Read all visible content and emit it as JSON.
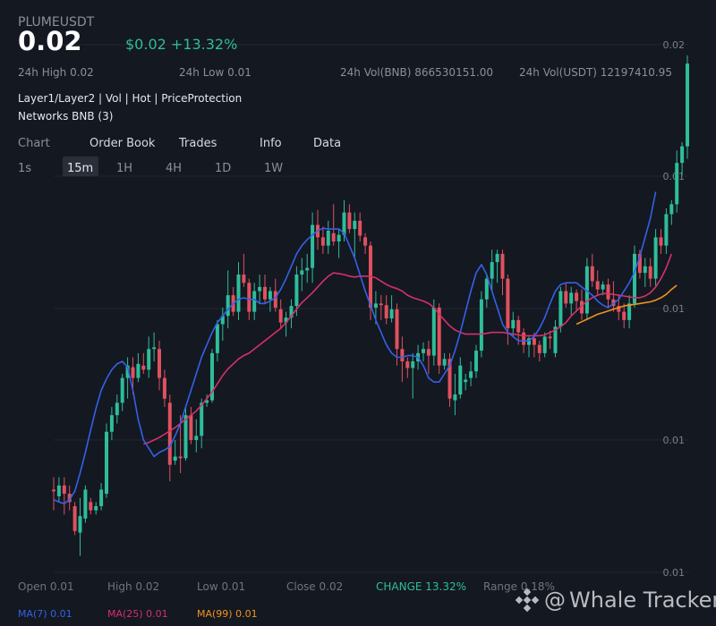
{
  "header": {
    "symbol": "PLUMEUSDT",
    "price": "0.02",
    "change": "$0.02 +13.32%"
  },
  "stats": {
    "high": "24h High 0.02",
    "low": "24h Low 0.01",
    "vol_bnb": "24h Vol(BNB) 866530151.00",
    "vol_usdt": "24h Vol(USDT) 12197410.95"
  },
  "tags": "Layer1/Layer2 | Vol | Hot | PriceProtection",
  "networks": "Networks BNB (3)",
  "tabs": [
    "Chart",
    "Order Book",
    "Trades",
    "Info",
    "Data"
  ],
  "intervals": [
    "1s",
    "15m",
    "1H",
    "4H",
    "1D",
    "1W"
  ],
  "active_interval": "15m",
  "footer": {
    "open": "Open 0.01",
    "high": "High 0.02",
    "low": "Low 0.01",
    "close": "Close 0.02",
    "change": "CHANGE 13.32%",
    "range": "Range 0.18%"
  },
  "ma": {
    "ma7": "MA(7) 0.01",
    "ma25": "MA(25) 0.01",
    "ma99": "MA(99) 0.01"
  },
  "watermark": "Whale Tracker",
  "colors": {
    "up": "#2ebd9a",
    "down": "#e0515f",
    "ma7": "#3461e8",
    "ma25": "#d6306b",
    "ma99": "#f0931e",
    "background": "#141821"
  },
  "chart_data": {
    "type": "candlestick",
    "y_tick_labels": [
      "0.02",
      "0.01",
      "0.01",
      "0.01",
      "0.01"
    ],
    "candles": [
      {
        "o": 0.0106,
        "h": 0.01075,
        "l": 0.01035,
        "c": 0.01058
      },
      {
        "o": 0.01052,
        "h": 0.01075,
        "l": 0.01045,
        "c": 0.01065
      },
      {
        "o": 0.01065,
        "h": 0.01075,
        "l": 0.0103,
        "c": 0.01055
      },
      {
        "o": 0.01055,
        "h": 0.01065,
        "l": 0.01035,
        "c": 0.01045
      },
      {
        "o": 0.0104,
        "h": 0.01045,
        "l": 0.01005,
        "c": 0.0101
      },
      {
        "o": 0.01008,
        "h": 0.0105,
        "l": 0.0098,
        "c": 0.01028
      },
      {
        "o": 0.01025,
        "h": 0.01065,
        "l": 0.0102,
        "c": 0.0106
      },
      {
        "o": 0.01045,
        "h": 0.0105,
        "l": 0.0103,
        "c": 0.01035
      },
      {
        "o": 0.01035,
        "h": 0.01045,
        "l": 0.0103,
        "c": 0.0104
      },
      {
        "o": 0.0104,
        "h": 0.01068,
        "l": 0.01035,
        "c": 0.0106
      },
      {
        "o": 0.01055,
        "h": 0.0114,
        "l": 0.0105,
        "c": 0.0113
      },
      {
        "o": 0.0113,
        "h": 0.0116,
        "l": 0.0112,
        "c": 0.0115
      },
      {
        "o": 0.0115,
        "h": 0.01175,
        "l": 0.0114,
        "c": 0.01165
      },
      {
        "o": 0.01165,
        "h": 0.012,
        "l": 0.01155,
        "c": 0.01195
      },
      {
        "o": 0.01195,
        "h": 0.0122,
        "l": 0.0117,
        "c": 0.0121
      },
      {
        "o": 0.01208,
        "h": 0.0122,
        "l": 0.01175,
        "c": 0.01195
      },
      {
        "o": 0.01195,
        "h": 0.01225,
        "l": 0.0119,
        "c": 0.01212
      },
      {
        "o": 0.0121,
        "h": 0.01225,
        "l": 0.012,
        "c": 0.01205
      },
      {
        "o": 0.01205,
        "h": 0.01245,
        "l": 0.01195,
        "c": 0.0123
      },
      {
        "o": 0.0123,
        "h": 0.0125,
        "l": 0.01215,
        "c": 0.01232
      },
      {
        "o": 0.0123,
        "h": 0.0124,
        "l": 0.0118,
        "c": 0.01195
      },
      {
        "o": 0.01195,
        "h": 0.01205,
        "l": 0.0116,
        "c": 0.0117
      },
      {
        "o": 0.01165,
        "h": 0.01175,
        "l": 0.0107,
        "c": 0.0109
      },
      {
        "o": 0.01095,
        "h": 0.0112,
        "l": 0.0109,
        "c": 0.011
      },
      {
        "o": 0.011,
        "h": 0.0115,
        "l": 0.0108,
        "c": 0.01098
      },
      {
        "o": 0.01098,
        "h": 0.0116,
        "l": 0.01095,
        "c": 0.0115
      },
      {
        "o": 0.0115,
        "h": 0.0116,
        "l": 0.01115,
        "c": 0.0112
      },
      {
        "o": 0.0112,
        "h": 0.01145,
        "l": 0.01105,
        "c": 0.01125
      },
      {
        "o": 0.01125,
        "h": 0.0117,
        "l": 0.0111,
        "c": 0.01165
      },
      {
        "o": 0.01165,
        "h": 0.01175,
        "l": 0.0116,
        "c": 0.01168
      },
      {
        "o": 0.01168,
        "h": 0.0123,
        "l": 0.01165,
        "c": 0.01225
      },
      {
        "o": 0.01225,
        "h": 0.01265,
        "l": 0.01215,
        "c": 0.0126
      },
      {
        "o": 0.0126,
        "h": 0.0128,
        "l": 0.0124,
        "c": 0.0127
      },
      {
        "o": 0.0127,
        "h": 0.01325,
        "l": 0.01255,
        "c": 0.01295
      },
      {
        "o": 0.01295,
        "h": 0.01305,
        "l": 0.0127,
        "c": 0.01275
      },
      {
        "o": 0.01275,
        "h": 0.01335,
        "l": 0.01265,
        "c": 0.0132
      },
      {
        "o": 0.0132,
        "h": 0.01345,
        "l": 0.01305,
        "c": 0.0131
      },
      {
        "o": 0.0131,
        "h": 0.01315,
        "l": 0.01265,
        "c": 0.01275
      },
      {
        "o": 0.01275,
        "h": 0.0131,
        "l": 0.01265,
        "c": 0.013
      },
      {
        "o": 0.013,
        "h": 0.0132,
        "l": 0.01285,
        "c": 0.01305
      },
      {
        "o": 0.01305,
        "h": 0.0132,
        "l": 0.01285,
        "c": 0.0129
      },
      {
        "o": 0.0129,
        "h": 0.01305,
        "l": 0.01275,
        "c": 0.013
      },
      {
        "o": 0.013,
        "h": 0.01315,
        "l": 0.01275,
        "c": 0.0128
      },
      {
        "o": 0.01278,
        "h": 0.0129,
        "l": 0.01255,
        "c": 0.01262
      },
      {
        "o": 0.01262,
        "h": 0.01275,
        "l": 0.01245,
        "c": 0.01268
      },
      {
        "o": 0.01268,
        "h": 0.0129,
        "l": 0.01255,
        "c": 0.01282
      },
      {
        "o": 0.01282,
        "h": 0.0133,
        "l": 0.0127,
        "c": 0.0132
      },
      {
        "o": 0.0132,
        "h": 0.0134,
        "l": 0.013,
        "c": 0.01325
      },
      {
        "o": 0.01325,
        "h": 0.01345,
        "l": 0.0131,
        "c": 0.01328
      },
      {
        "o": 0.01328,
        "h": 0.01395,
        "l": 0.0131,
        "c": 0.0138
      },
      {
        "o": 0.0138,
        "h": 0.01398,
        "l": 0.0135,
        "c": 0.01365
      },
      {
        "o": 0.01365,
        "h": 0.01378,
        "l": 0.01345,
        "c": 0.01355
      },
      {
        "o": 0.01355,
        "h": 0.01385,
        "l": 0.01345,
        "c": 0.01373
      },
      {
        "o": 0.0137,
        "h": 0.01405,
        "l": 0.01355,
        "c": 0.0136
      },
      {
        "o": 0.0136,
        "h": 0.01375,
        "l": 0.0134,
        "c": 0.01368
      },
      {
        "o": 0.01368,
        "h": 0.0141,
        "l": 0.0136,
        "c": 0.01395
      },
      {
        "o": 0.01395,
        "h": 0.01405,
        "l": 0.0137,
        "c": 0.01375
      },
      {
        "o": 0.01375,
        "h": 0.01395,
        "l": 0.0134,
        "c": 0.01385
      },
      {
        "o": 0.01385,
        "h": 0.01395,
        "l": 0.0136,
        "c": 0.01367
      },
      {
        "o": 0.01365,
        "h": 0.0137,
        "l": 0.01345,
        "c": 0.01355
      },
      {
        "o": 0.01355,
        "h": 0.0136,
        "l": 0.01265,
        "c": 0.0128
      },
      {
        "o": 0.0128,
        "h": 0.013,
        "l": 0.0126,
        "c": 0.01285
      },
      {
        "o": 0.01285,
        "h": 0.01295,
        "l": 0.01265,
        "c": 0.01283
      },
      {
        "o": 0.01283,
        "h": 0.01295,
        "l": 0.0126,
        "c": 0.01267
      },
      {
        "o": 0.01267,
        "h": 0.01295,
        "l": 0.01262,
        "c": 0.01278
      },
      {
        "o": 0.01278,
        "h": 0.01285,
        "l": 0.0121,
        "c": 0.0123
      },
      {
        "o": 0.0123,
        "h": 0.01245,
        "l": 0.0119,
        "c": 0.01215
      },
      {
        "o": 0.01215,
        "h": 0.0122,
        "l": 0.01195,
        "c": 0.01207
      },
      {
        "o": 0.01207,
        "h": 0.01225,
        "l": 0.0117,
        "c": 0.01215
      },
      {
        "o": 0.01215,
        "h": 0.01235,
        "l": 0.01205,
        "c": 0.01225
      },
      {
        "o": 0.01225,
        "h": 0.01238,
        "l": 0.01215,
        "c": 0.0123
      },
      {
        "o": 0.0123,
        "h": 0.0124,
        "l": 0.012,
        "c": 0.01222
      },
      {
        "o": 0.01222,
        "h": 0.0129,
        "l": 0.0121,
        "c": 0.0128
      },
      {
        "o": 0.0128,
        "h": 0.01285,
        "l": 0.012,
        "c": 0.0121
      },
      {
        "o": 0.0121,
        "h": 0.01225,
        "l": 0.01205,
        "c": 0.01218
      },
      {
        "o": 0.01218,
        "h": 0.01225,
        "l": 0.0116,
        "c": 0.0117
      },
      {
        "o": 0.01168,
        "h": 0.012,
        "l": 0.0115,
        "c": 0.01175
      },
      {
        "o": 0.01175,
        "h": 0.0122,
        "l": 0.0117,
        "c": 0.0121
      },
      {
        "o": 0.0119,
        "h": 0.012,
        "l": 0.0118,
        "c": 0.01193
      },
      {
        "o": 0.01195,
        "h": 0.01215,
        "l": 0.01185,
        "c": 0.01203
      },
      {
        "o": 0.01203,
        "h": 0.01235,
        "l": 0.01195,
        "c": 0.01228
      },
      {
        "o": 0.01228,
        "h": 0.013,
        "l": 0.0122,
        "c": 0.0129
      },
      {
        "o": 0.0129,
        "h": 0.0132,
        "l": 0.0128,
        "c": 0.01315
      },
      {
        "o": 0.01315,
        "h": 0.0135,
        "l": 0.013,
        "c": 0.01335
      },
      {
        "o": 0.01335,
        "h": 0.0135,
        "l": 0.0131,
        "c": 0.01345
      },
      {
        "o": 0.01345,
        "h": 0.0135,
        "l": 0.01295,
        "c": 0.01315
      },
      {
        "o": 0.01315,
        "h": 0.0132,
        "l": 0.01235,
        "c": 0.01255
      },
      {
        "o": 0.01255,
        "h": 0.01275,
        "l": 0.01245,
        "c": 0.01265
      },
      {
        "o": 0.01265,
        "h": 0.0127,
        "l": 0.01235,
        "c": 0.0125
      },
      {
        "o": 0.0125,
        "h": 0.01255,
        "l": 0.01225,
        "c": 0.01235
      },
      {
        "o": 0.01235,
        "h": 0.01245,
        "l": 0.0122,
        "c": 0.01243
      },
      {
        "o": 0.01243,
        "h": 0.0125,
        "l": 0.0122,
        "c": 0.01235
      },
      {
        "o": 0.01235,
        "h": 0.0124,
        "l": 0.01215,
        "c": 0.01225
      },
      {
        "o": 0.01225,
        "h": 0.0125,
        "l": 0.0122,
        "c": 0.01245
      },
      {
        "o": 0.01245,
        "h": 0.01252,
        "l": 0.0123,
        "c": 0.01243
      },
      {
        "o": 0.01225,
        "h": 0.01265,
        "l": 0.0122,
        "c": 0.01257
      },
      {
        "o": 0.01257,
        "h": 0.01305,
        "l": 0.0125,
        "c": 0.013
      },
      {
        "o": 0.013,
        "h": 0.0131,
        "l": 0.0128,
        "c": 0.01285
      },
      {
        "o": 0.01285,
        "h": 0.01305,
        "l": 0.0127,
        "c": 0.01298
      },
      {
        "o": 0.01298,
        "h": 0.01302,
        "l": 0.01275,
        "c": 0.01288
      },
      {
        "o": 0.01288,
        "h": 0.01302,
        "l": 0.01265,
        "c": 0.01273
      },
      {
        "o": 0.01273,
        "h": 0.0134,
        "l": 0.01265,
        "c": 0.0133
      },
      {
        "o": 0.0133,
        "h": 0.01345,
        "l": 0.01305,
        "c": 0.01312
      },
      {
        "o": 0.01312,
        "h": 0.01325,
        "l": 0.01295,
        "c": 0.01302
      },
      {
        "o": 0.01302,
        "h": 0.01312,
        "l": 0.01295,
        "c": 0.01308
      },
      {
        "o": 0.01308,
        "h": 0.01315,
        "l": 0.0128,
        "c": 0.0129
      },
      {
        "o": 0.0129,
        "h": 0.01312,
        "l": 0.01275,
        "c": 0.01282
      },
      {
        "o": 0.01282,
        "h": 0.01295,
        "l": 0.01265,
        "c": 0.01275
      },
      {
        "o": 0.01275,
        "h": 0.01285,
        "l": 0.01255,
        "c": 0.01265
      },
      {
        "o": 0.01265,
        "h": 0.01295,
        "l": 0.01255,
        "c": 0.01285
      },
      {
        "o": 0.01285,
        "h": 0.01355,
        "l": 0.0128,
        "c": 0.01345
      },
      {
        "o": 0.01345,
        "h": 0.0135,
        "l": 0.01315,
        "c": 0.01322
      },
      {
        "o": 0.01322,
        "h": 0.0134,
        "l": 0.01305,
        "c": 0.0133
      },
      {
        "o": 0.0133,
        "h": 0.0134,
        "l": 0.01305,
        "c": 0.01315
      },
      {
        "o": 0.01315,
        "h": 0.01375,
        "l": 0.01305,
        "c": 0.01365
      },
      {
        "o": 0.01365,
        "h": 0.01375,
        "l": 0.01345,
        "c": 0.01355
      },
      {
        "o": 0.01355,
        "h": 0.014,
        "l": 0.01345,
        "c": 0.01393
      },
      {
        "o": 0.01393,
        "h": 0.0141,
        "l": 0.0138,
        "c": 0.01405
      },
      {
        "o": 0.01405,
        "h": 0.0147,
        "l": 0.01395,
        "c": 0.01455
      },
      {
        "o": 0.01455,
        "h": 0.0148,
        "l": 0.0144,
        "c": 0.01475
      },
      {
        "o": 0.01475,
        "h": 0.01585,
        "l": 0.0146,
        "c": 0.01575
      }
    ],
    "ma7": [
      0.01048,
      0.01045,
      0.01043,
      0.01048,
      0.01058,
      0.0108,
      0.01105,
      0.01132,
      0.01158,
      0.0118,
      0.01194,
      0.01205,
      0.01212,
      0.01215,
      0.01208,
      0.0118,
      0.01145,
      0.0112,
      0.0111,
      0.011,
      0.01105,
      0.01108,
      0.01112,
      0.01125,
      0.0114,
      0.0116,
      0.0118,
      0.012,
      0.0122,
      0.01235,
      0.0125,
      0.01262,
      0.0127,
      0.01278,
      0.01285,
      0.0129,
      0.01292,
      0.0129,
      0.0129,
      0.01285,
      0.01285,
      0.01288,
      0.01292,
      0.01302,
      0.01315,
      0.0133,
      0.01345,
      0.01355,
      0.01362,
      0.01368,
      0.01373,
      0.01376,
      0.01375,
      0.01375,
      0.01375,
      0.0137,
      0.01355,
      0.0134,
      0.0132,
      0.013,
      0.01283,
      0.01265,
      0.0125,
      0.01235,
      0.01225,
      0.0122,
      0.0122,
      0.01222,
      0.01222,
      0.0122,
      0.0121,
      0.01195,
      0.0119,
      0.0119,
      0.012,
      0.0121,
      0.01228,
      0.0125,
      0.01275,
      0.013,
      0.01322,
      0.01332,
      0.0132,
      0.013,
      0.0128,
      0.0126,
      0.0125,
      0.01245,
      0.0124,
      0.0124,
      0.0124,
      0.01245,
      0.01255,
      0.01268,
      0.01285,
      0.013,
      0.01308,
      0.0131,
      0.0131,
      0.0131,
      0.01305,
      0.013,
      0.01295,
      0.01288,
      0.01283,
      0.0128,
      0.01285,
      0.0129,
      0.013,
      0.0131,
      0.01323,
      0.01342,
      0.01365,
      0.01388,
      0.0142
    ],
    "ma25_start": 17,
    "ma25": [
      0.01115,
      0.01117,
      0.0112,
      0.01123,
      0.01127,
      0.01131,
      0.01135,
      0.0114,
      0.01145,
      0.0115,
      0.01155,
      0.01162,
      0.0117,
      0.01178,
      0.01188,
      0.01198,
      0.01206,
      0.01212,
      0.01218,
      0.01222,
      0.01225,
      0.0123,
      0.01235,
      0.0124,
      0.01245,
      0.0125,
      0.01255,
      0.01262,
      0.0127,
      0.01278,
      0.01286,
      0.01292,
      0.01298,
      0.01305,
      0.01312,
      0.01318,
      0.01322,
      0.01321,
      0.0132,
      0.01318,
      0.01317,
      0.01318,
      0.01318,
      0.01318,
      0.01316,
      0.01312,
      0.01308,
      0.01305,
      0.01303,
      0.013,
      0.01295,
      0.01292,
      0.0129,
      0.01288,
      0.01285,
      0.0128,
      0.01272,
      0.01265,
      0.01258,
      0.01253,
      0.0125,
      0.01248,
      0.01248,
      0.01248,
      0.01248,
      0.01249,
      0.0125,
      0.0125,
      0.0125,
      0.01249,
      0.01248,
      0.01247,
      0.01246,
      0.01246,
      0.01246,
      0.01246,
      0.01247,
      0.0125,
      0.01253,
      0.01257,
      0.01262,
      0.0127,
      0.01276,
      0.01282,
      0.01288,
      0.01292,
      0.01295,
      0.01297,
      0.01297,
      0.01296,
      0.01295,
      0.01294,
      0.01293,
      0.01292,
      0.01292,
      0.01294,
      0.01298,
      0.01305,
      0.01315,
      0.01328,
      0.01345
    ],
    "ma99_start": 99,
    "ma99": [
      0.0126,
      0.01263,
      0.01266,
      0.01269,
      0.01272,
      0.01274,
      0.01276,
      0.01278,
      0.0128,
      0.01282,
      0.01283,
      0.01284,
      0.01285,
      0.01286,
      0.01287,
      0.01289,
      0.01292,
      0.01296,
      0.01302,
      0.01307
    ]
  }
}
